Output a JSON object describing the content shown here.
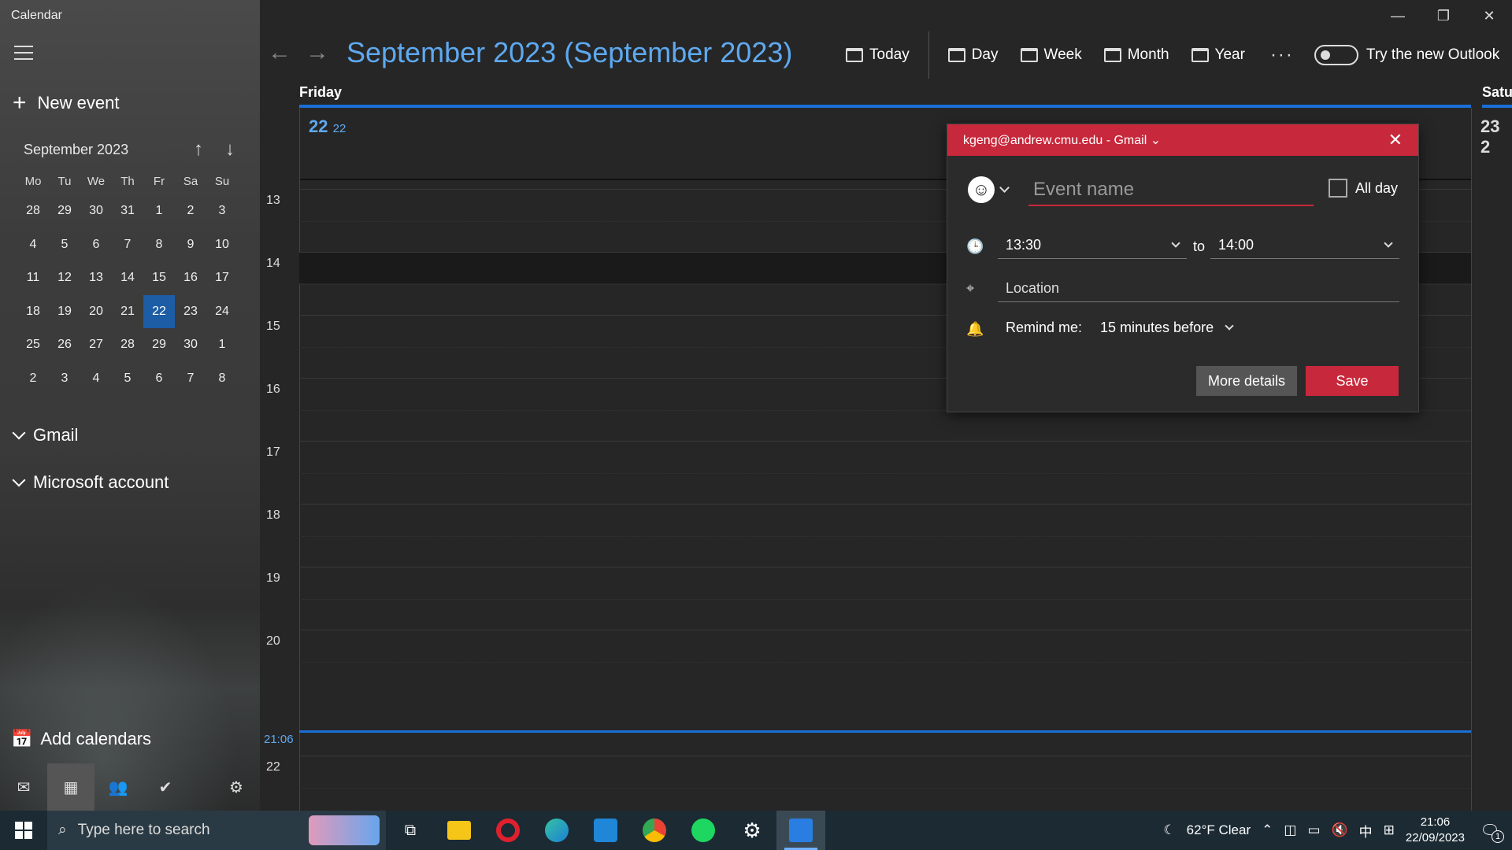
{
  "app": {
    "title": "Calendar"
  },
  "sidebar": {
    "new_event_label": "New event",
    "mini_calendar": {
      "month_label": "September 2023",
      "weekdays": [
        "Mo",
        "Tu",
        "We",
        "Th",
        "Fr",
        "Sa",
        "Su"
      ],
      "weeks": [
        [
          "28",
          "29",
          "30",
          "31",
          "1",
          "2",
          "3"
        ],
        [
          "4",
          "5",
          "6",
          "7",
          "8",
          "9",
          "10"
        ],
        [
          "11",
          "12",
          "13",
          "14",
          "15",
          "16",
          "17"
        ],
        [
          "18",
          "19",
          "20",
          "21",
          "22",
          "23",
          "24"
        ],
        [
          "25",
          "26",
          "27",
          "28",
          "29",
          "30",
          "1"
        ],
        [
          "2",
          "3",
          "4",
          "5",
          "6",
          "7",
          "8"
        ]
      ],
      "selected_day": "22"
    },
    "accounts": [
      {
        "label": "Gmail"
      },
      {
        "label": "Microsoft account"
      }
    ],
    "add_calendars_label": "Add calendars"
  },
  "header": {
    "title": "September 2023 (September 2023)",
    "today_label": "Today",
    "day_label": "Day",
    "week_label": "Week",
    "month_label": "Month",
    "year_label": "Year",
    "more_label": "···",
    "toggle_label": "Try the new Outlook"
  },
  "day_view": {
    "day_name": "Friday",
    "date": "22",
    "date_small": "22",
    "next_day_name": "Satu",
    "next_date": "23 2",
    "hours": [
      "13",
      "14",
      "15",
      "16",
      "17",
      "18",
      "19",
      "20",
      "22"
    ],
    "current_time": "21:06"
  },
  "popup": {
    "account": "kgeng@andrew.cmu.edu - Gmail",
    "event_name_placeholder": "Event name",
    "all_day_label": "All day",
    "start_time": "13:30",
    "to_label": "to",
    "end_time": "14:00",
    "location_placeholder": "Location",
    "remind_label": "Remind me:",
    "remind_value": "15 minutes before",
    "more_details_label": "More details",
    "save_label": "Save",
    "accent_color": "#c8283b"
  },
  "taskbar": {
    "search_placeholder": "Type here to search",
    "weather": "62°F  Clear",
    "ime": "中",
    "time": "21:06",
    "date": "22/09/2023",
    "notification_count": "1"
  }
}
